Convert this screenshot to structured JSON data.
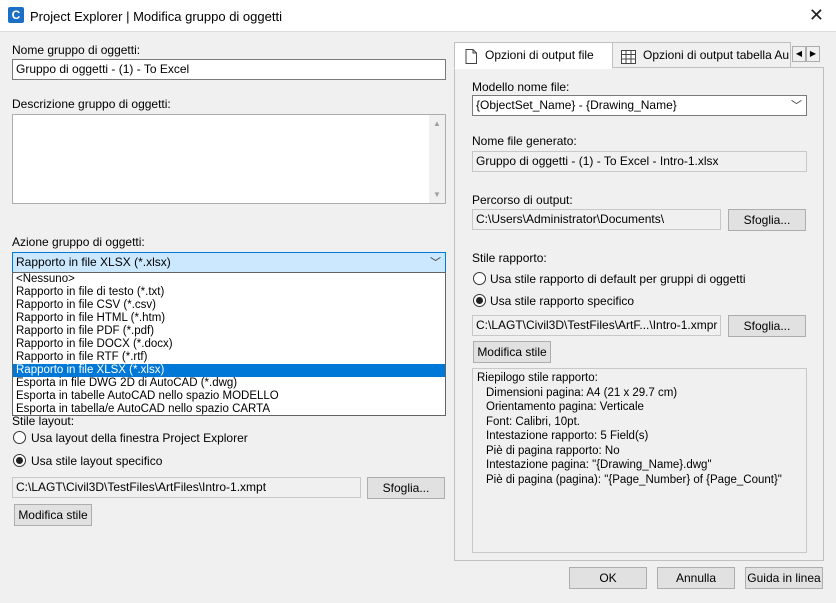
{
  "window": {
    "title": "Project Explorer | Modifica gruppo di oggetti",
    "app_icon_letter": "C"
  },
  "left": {
    "name_label": "Nome gruppo di oggetti:",
    "name_value": "Gruppo di oggetti - (1) - To Excel",
    "description_label": "Descrizione gruppo di oggetti:",
    "description_value": "",
    "action_label": "Azione gruppo di oggetti:",
    "action_selected": "Rapporto in file XLSX (*.xlsx)",
    "action_options": [
      "<Nessuno>",
      "Rapporto in file di testo (*.txt)",
      "Rapporto in file CSV (*.csv)",
      "Rapporto in file HTML (*.htm)",
      "Rapporto in file PDF (*.pdf)",
      "Rapporto in file DOCX (*.docx)",
      "Rapporto in file RTF (*.rtf)",
      "Rapporto in file XLSX (*.xlsx)",
      "Esporta in file DWG 2D di AutoCAD (*.dwg)",
      "Esporta in tabelle AutoCAD nello spazio MODELLO",
      "Esporta in tabella/e AutoCAD nello spazio CARTA"
    ],
    "action_selected_index": 7,
    "layout_label": "Stile layout:",
    "layout_option_window": "Usa layout della finestra Project Explorer",
    "layout_option_specific": "Usa stile layout specifico",
    "layout_path": "C:\\LAGT\\Civil3D\\TestFiles\\ArtFiles\\Intro-1.xmpt",
    "browse_label": "Sfoglia...",
    "edit_style_label": "Modifica stile"
  },
  "tabs": [
    {
      "label": "Opzioni di output file",
      "icon": "document-icon",
      "active": true
    },
    {
      "label": "Opzioni di output tabella Au",
      "icon": "table-icon",
      "active": false
    }
  ],
  "right": {
    "template_label": "Modello nome file:",
    "template_value": "{ObjectSet_Name} - {Drawing_Name}",
    "generated_label": "Nome file generato:",
    "generated_value": "Gruppo di oggetti - (1) - To Excel - Intro-1.xlsx",
    "output_path_label": "Percorso di output:",
    "output_path_value": "C:\\Users\\Administrator\\Documents\\",
    "browse_label": "Sfoglia...",
    "report_style_label": "Stile rapporto:",
    "report_option_default": "Usa stile rapporto di default per gruppi di oggetti",
    "report_option_specific": "Usa stile rapporto specifico",
    "report_path": "C:\\LAGT\\Civil3D\\TestFiles\\ArtF...\\Intro-1.xmpr",
    "edit_style_label": "Modifica stile",
    "summary": {
      "header": "Riepilogo stile rapporto:",
      "lines": [
        "Dimensioni pagina: A4 (21 x 29.7 cm)",
        "Orientamento pagina: Verticale",
        "Font: Calibri, 10pt.",
        "Intestazione rapporto: 5 Field(s)",
        "Piè di pagina rapporto: No",
        "Intestazione pagina: \"{Drawing_Name}.dwg\"",
        "Piè di pagina (pagina): \"{Page_Number} of {Page_Count}\""
      ]
    }
  },
  "footer": {
    "ok": "OK",
    "cancel": "Annulla",
    "help": "Guida in linea"
  }
}
